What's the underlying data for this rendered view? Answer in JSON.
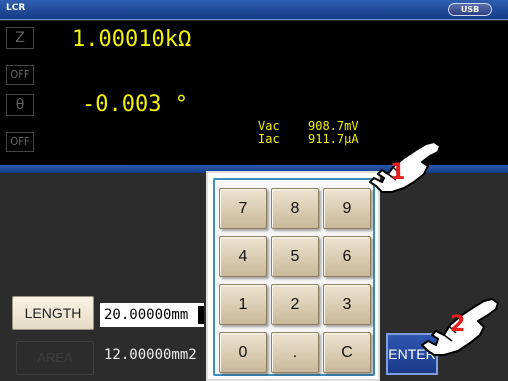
{
  "title": {
    "mode": "LCR",
    "usb_label": "USB"
  },
  "measurement": {
    "param1": {
      "symbol": "Z",
      "value": "1.00010kΩ",
      "range_label": "OFF"
    },
    "param2": {
      "symbol": "θ",
      "value": "-0.003 °",
      "range_label": "OFF"
    },
    "monitor": [
      {
        "label": "Vac",
        "value": "908.7mV"
      },
      {
        "label": "Iac",
        "value": "911.7μA"
      }
    ]
  },
  "settings": {
    "length_label": "LENGTH",
    "length_value": "20.00000mm",
    "area_label": "AREA",
    "area_value": "12.00000mm2"
  },
  "keypad": {
    "keys": [
      "7",
      "8",
      "9",
      "4",
      "5",
      "6",
      "1",
      "2",
      "3",
      "0",
      ".",
      "C"
    ],
    "enter_label": "ENTER"
  },
  "callouts": [
    "1",
    "2"
  ],
  "colors": {
    "readout": "#f2f209",
    "title_bar": "#143a86",
    "callout": "#e41d1d",
    "key": "#e3d6bd"
  }
}
